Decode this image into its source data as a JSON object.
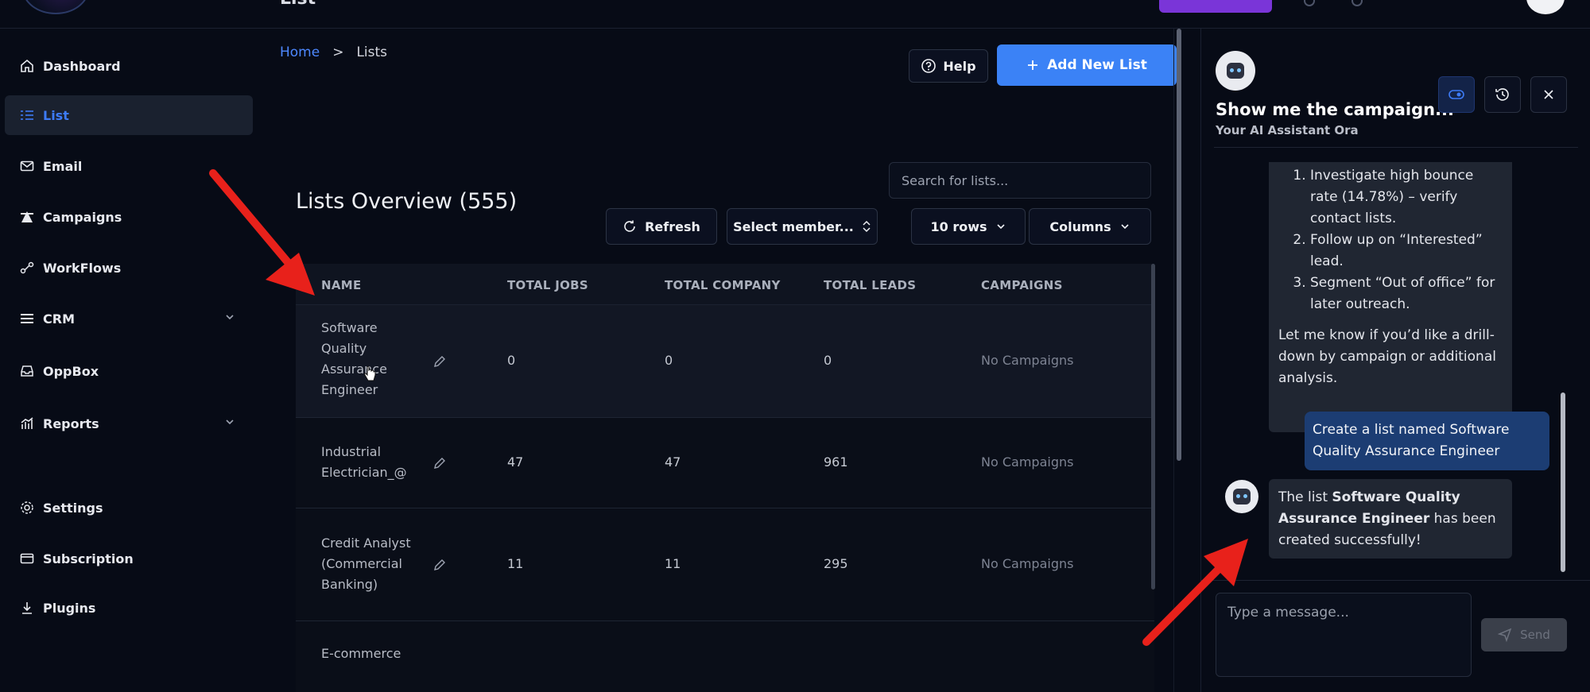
{
  "header": {
    "title": "List"
  },
  "sidebar": {
    "items": [
      {
        "label": "Dashboard",
        "icon": "home-icon"
      },
      {
        "label": "List",
        "icon": "list-icon",
        "active": true
      },
      {
        "label": "Email",
        "icon": "mail-icon"
      },
      {
        "label": "Campaigns",
        "icon": "campaign-icon"
      },
      {
        "label": "WorkFlows",
        "icon": "workflow-icon"
      },
      {
        "label": "CRM",
        "icon": "menu-icon",
        "expandable": true
      },
      {
        "label": "OppBox",
        "icon": "inbox-icon"
      },
      {
        "label": "Reports",
        "icon": "chart-icon",
        "expandable": true
      },
      {
        "label": "Settings",
        "icon": "gear-icon"
      },
      {
        "label": "Subscription",
        "icon": "card-icon"
      },
      {
        "label": "Plugins",
        "icon": "download-icon"
      }
    ]
  },
  "breadcrumb": {
    "home": "Home",
    "separator": ">",
    "current": "Lists"
  },
  "toolbar": {
    "help_label": "Help",
    "add_label": "Add New List",
    "search_placeholder": "Search for lists...",
    "refresh_label": "Refresh",
    "member_select": "Select member...",
    "rows_select": "10 rows",
    "columns_label": "Columns"
  },
  "lists": {
    "title": "Lists Overview (555)",
    "columns": [
      "NAME",
      "TOTAL JOBS",
      "TOTAL COMPANY",
      "TOTAL LEADS",
      "CAMPAIGNS"
    ],
    "rows": [
      {
        "name_lines": [
          "Software",
          "Quality",
          "Assurance",
          "Engineer"
        ],
        "jobs": "0",
        "company": "0",
        "leads": "0",
        "campaigns": "No Campaigns"
      },
      {
        "name_lines": [
          "Industrial",
          "Electrician_@"
        ],
        "jobs": "47",
        "company": "47",
        "leads": "961",
        "campaigns": "No Campaigns"
      },
      {
        "name_lines": [
          "Credit Analyst",
          "(Commercial",
          "Banking)"
        ],
        "jobs": "11",
        "company": "11",
        "leads": "295",
        "campaigns": "No Campaigns"
      },
      {
        "name_lines": [
          "E-commerce"
        ],
        "jobs": "",
        "company": "",
        "leads": "",
        "campaigns": ""
      }
    ]
  },
  "chat": {
    "title": "Show me the campaign...",
    "subtitle": "Your AI Assistant Ora",
    "messages": {
      "bot1_items": [
        "Investigate high bounce rate (14.78%) – verify contact lists.",
        "Follow up on “Interested” lead.",
        "Segment “Out of office” for later outreach."
      ],
      "bot1_text": "Let me know if you’d like a drill-down by campaign or additional analysis.",
      "user1": "Create a list named Software Quality Assurance Engineer",
      "bot2_prefix": "The list ",
      "bot2_bold": "Software Quality Assurance Engineer",
      "bot2_suffix": " has been created successfully!"
    },
    "input_placeholder": "Type a message...",
    "send_label": "Send"
  },
  "colors": {
    "accent": "#3b82f6",
    "annotation": "#e8211b",
    "brand_purple": "#7a35d8"
  }
}
